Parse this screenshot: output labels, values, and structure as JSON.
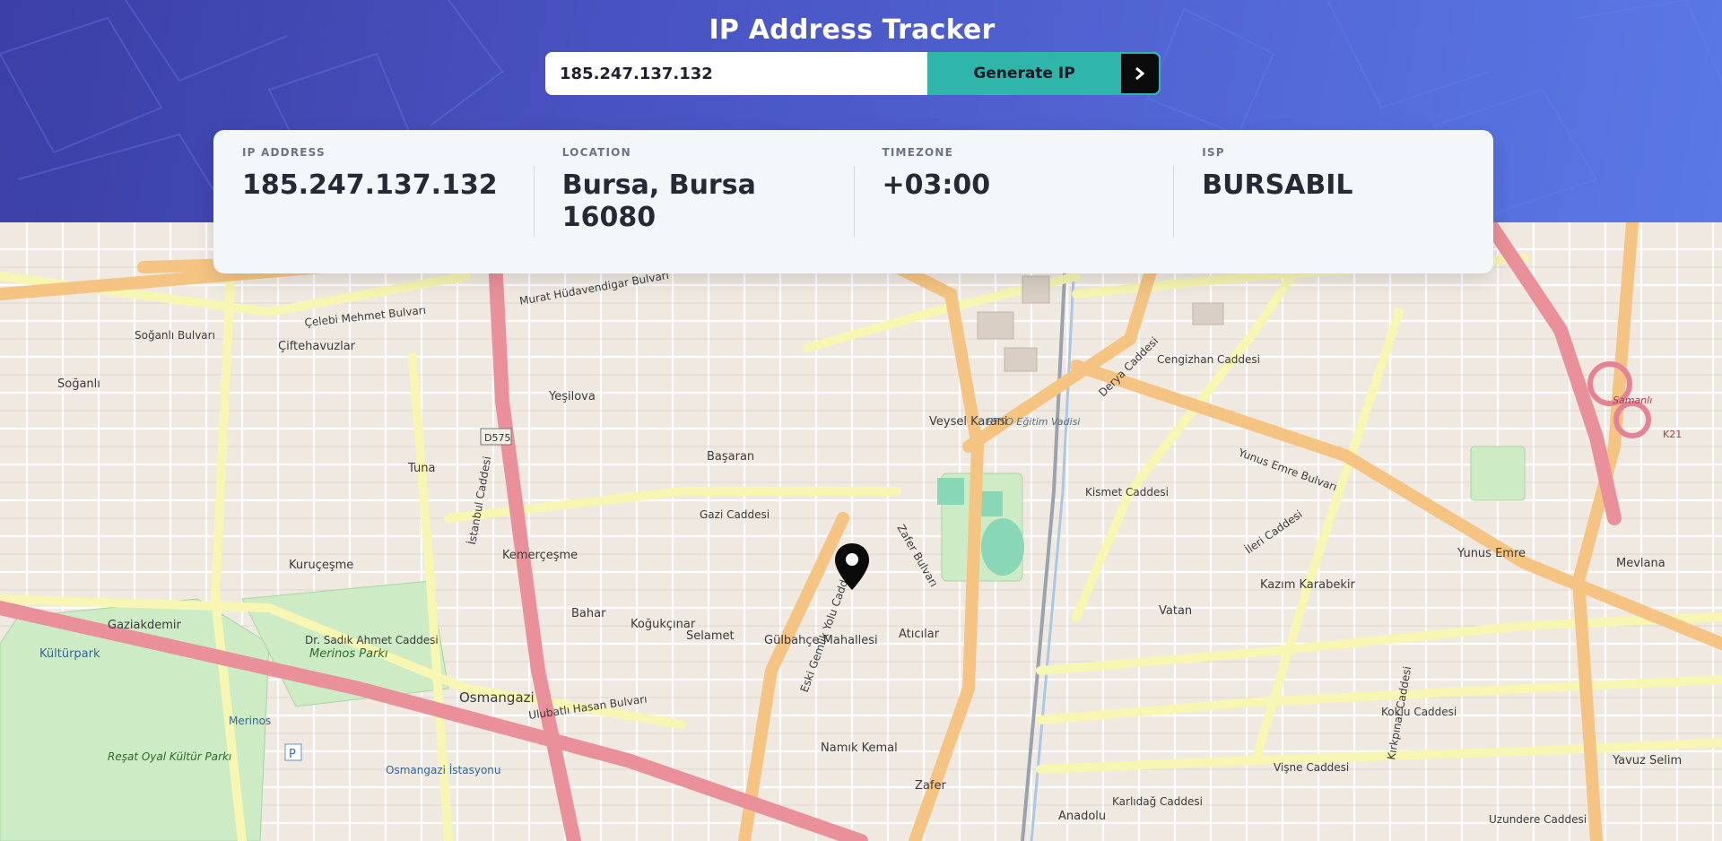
{
  "header": {
    "title": "IP Address Tracker",
    "search": {
      "value": "185.247.137.132",
      "placeholder": "185.247.137.132",
      "generate_label": "Generate IP",
      "submit_icon": "chevron-right-icon"
    }
  },
  "info": {
    "ip": {
      "label": "IP ADDRESS",
      "value": "185.247.137.132"
    },
    "location": {
      "label": "LOCATION",
      "value": "Bursa, Bursa 16080"
    },
    "timezone": {
      "label": "TIMEZONE",
      "value": "+03:00"
    },
    "isp": {
      "label": "ISP",
      "value": "BURSABIL"
    }
  },
  "map": {
    "marker_icon": "location-pin-icon",
    "places": [
      "Osmangazi",
      "Kültürpark",
      "Merinos Parkı",
      "Merinos",
      "Reşat Oyal Kültür Parkı",
      "Osmangazi İstasyonu",
      "Kemerçeşme",
      "Başaran",
      "Gülbahçe Mahallesi",
      "Atıcılar",
      "Namık Kemal",
      "Yunus Emre",
      "Mevlana",
      "Kazım Karabekir",
      "Vatan",
      "Selamet",
      "Koğukçınar",
      "Bahar",
      "Tuna",
      "Kuruçeşme",
      "Çiftehavuzlar",
      "Soğanlı",
      "Gaziakdemir",
      "Yavuz Selim",
      "Anadolu",
      "Zafer",
      "Veysel Karani",
      "Yeşilova",
      "BTSO Eğitim Vadisi",
      "Samanlı"
    ],
    "streets": [
      "Ulubatlı Hasan Bulvarı",
      "Gazi Caddesi",
      "Zafer Bulvarı",
      "Yunus Emre Bulvarı",
      "İstanbul Caddesi",
      "Çelebi Mehmet Bulvarı",
      "Murat Hüdavendigar Bulvarı",
      "Dr. Sadık Ahmet Caddesi",
      "Koklu Caddesi",
      "Vişne Caddesi",
      "Karlıdağ Caddesi",
      "Uzundere Caddesi",
      "Eski Gemlik Yolu Caddesi",
      "Soğanlı Bulvarı",
      "Cengizhan Caddesi",
      "Kismet Caddesi",
      "Derya Caddesi",
      "İleri Caddesi",
      "Kırkpınar Caddesi"
    ],
    "road_codes": [
      "D575",
      "K21"
    ]
  }
}
